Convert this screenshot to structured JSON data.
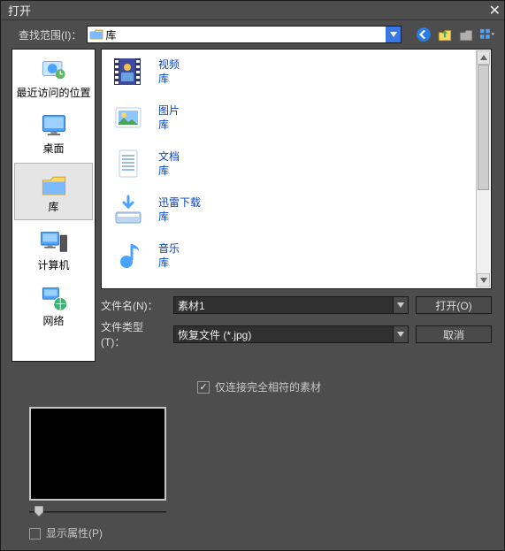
{
  "title": "打开",
  "lookin_label": "查找范围(I)：",
  "path_text": "库",
  "sidebar": {
    "items": [
      {
        "label": "最近访问的位置"
      },
      {
        "label": "桌面"
      },
      {
        "label": "库"
      },
      {
        "label": "计算机"
      },
      {
        "label": "网络"
      }
    ]
  },
  "list": {
    "items": [
      {
        "name": "视频",
        "sub": "库"
      },
      {
        "name": "图片",
        "sub": "库"
      },
      {
        "name": "文档",
        "sub": "库"
      },
      {
        "name": "迅雷下载",
        "sub": "库"
      },
      {
        "name": "音乐",
        "sub": "库"
      }
    ]
  },
  "filename_label": "文件名(N)：",
  "filename_value": "素材1",
  "filetype_label": "文件类型(T)：",
  "filetype_value": "恢复文件 (*.jpg)",
  "open_btn": "打开(O)",
  "cancel_btn": "取消",
  "exactmatch_label": "仅连接完全相符的素材",
  "showprops_label": "显示属性(P)"
}
